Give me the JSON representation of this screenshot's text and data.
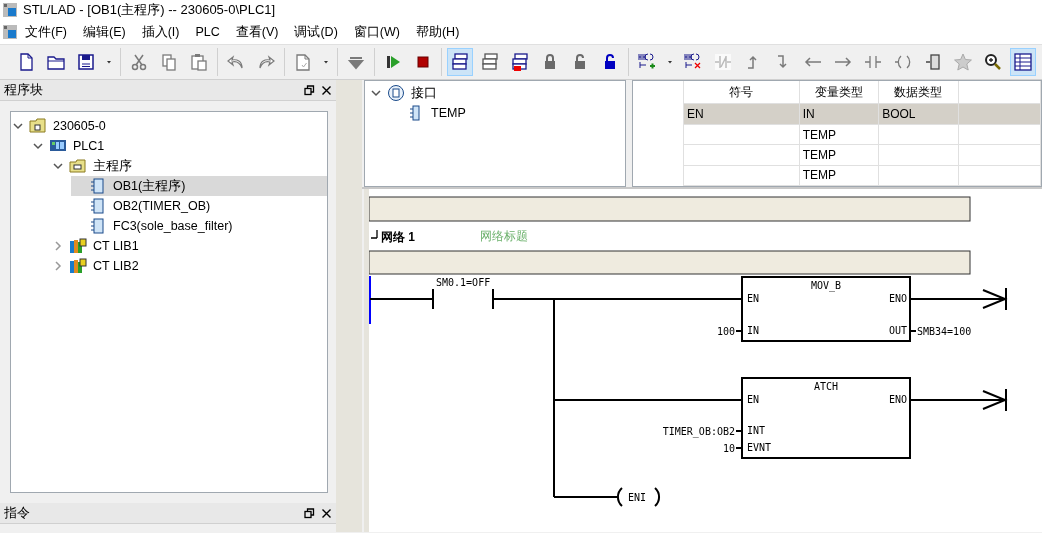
{
  "window": {
    "title": "STL/LAD - [OB1(主程序) -- 230605-0\\PLC1]"
  },
  "menu": [
    "文件(F)",
    "编辑(E)",
    "插入(I)",
    "PLC",
    "查看(V)",
    "调试(D)",
    "窗口(W)",
    "帮助(H)"
  ],
  "toolbar": {
    "groups": [
      {
        "items": [
          {
            "kind": "new-file",
            "selected": false
          },
          {
            "kind": "folder",
            "selected": false
          },
          {
            "kind": "floppy-disk",
            "selected": false
          },
          {
            "kind": "caret",
            "selected": false
          }
        ]
      },
      {
        "items": [
          {
            "kind": "scissors",
            "selected": false
          },
          {
            "kind": "copy",
            "selected": false
          },
          {
            "kind": "clipboard",
            "selected": false
          }
        ]
      },
      {
        "items": [
          {
            "kind": "undo",
            "selected": false
          },
          {
            "kind": "redo",
            "selected": false
          }
        ]
      },
      {
        "items": [
          {
            "kind": "compile",
            "selected": false
          },
          {
            "kind": "caret",
            "selected": false
          }
        ]
      },
      {
        "items": [
          {
            "kind": "download",
            "selected": false
          }
        ]
      },
      {
        "items": [
          {
            "kind": "play",
            "selected": false
          },
          {
            "kind": "stop",
            "selected": false
          }
        ]
      },
      {
        "items": [
          {
            "kind": "window-stack",
            "selected": true
          },
          {
            "kind": "window-stack-outline",
            "selected": false
          },
          {
            "kind": "window-stack-marked",
            "selected": false
          },
          {
            "kind": "lock",
            "selected": false
          },
          {
            "kind": "unlock",
            "selected": false
          },
          {
            "kind": "unlock-dropdown",
            "selected": false
          }
        ]
      },
      {
        "items": [
          {
            "kind": "insert-network",
            "selected": false
          },
          {
            "kind": "caret",
            "selected": false
          },
          {
            "kind": "delete-network",
            "selected": false
          },
          {
            "kind": "negate",
            "selected": false
          },
          {
            "kind": "line-up",
            "selected": false
          },
          {
            "kind": "line-down",
            "selected": false
          },
          {
            "kind": "arrow-left",
            "selected": false
          },
          {
            "kind": "arrow-right",
            "selected": false
          },
          {
            "kind": "contact",
            "selected": false
          },
          {
            "kind": "coil",
            "selected": false
          },
          {
            "kind": "box",
            "selected": false
          },
          {
            "kind": "star",
            "selected": false
          },
          {
            "kind": "zoom",
            "selected": false
          },
          {
            "kind": "grid",
            "selected": true
          }
        ]
      }
    ]
  },
  "program_blocks": {
    "title": "程序块",
    "items": [
      {
        "label": "230605-0",
        "kind": "project",
        "expanded": true,
        "selected": false,
        "children": [
          {
            "label": "PLC1",
            "kind": "plc",
            "expanded": true,
            "selected": false,
            "children": [
              {
                "label": "主程序",
                "kind": "folder",
                "expanded": true,
                "selected": false,
                "children": [
                  {
                    "label": "OB1(主程序)",
                    "kind": "block",
                    "selected": true
                  },
                  {
                    "label": "OB2(TIMER_OB)",
                    "kind": "block",
                    "selected": false
                  },
                  {
                    "label": "FC3(sole_base_filter)",
                    "kind": "block",
                    "selected": false
                  }
                ]
              },
              {
                "label": "CT LIB1",
                "kind": "library",
                "expanded": false,
                "selected": false
              },
              {
                "label": "CT LIB2",
                "kind": "library",
                "expanded": false,
                "selected": false
              }
            ]
          }
        ]
      }
    ]
  },
  "instructions": {
    "title": "指令"
  },
  "interface": {
    "items": [
      {
        "label": "接口",
        "kind": "interface",
        "expanded": true,
        "children": [
          {
            "label": "TEMP",
            "kind": "pin"
          }
        ]
      }
    ]
  },
  "variable_table": {
    "columns": [
      "符号",
      "变量类型",
      "数据类型"
    ],
    "rows": [
      {
        "symbol": "EN",
        "var_type": "IN",
        "data_type": "BOOL",
        "selected": true
      },
      {
        "var_type": "TEMP",
        "selected": false
      },
      {
        "var_type": "TEMP",
        "selected": false
      },
      {
        "var_type": "TEMP",
        "selected": false
      }
    ]
  },
  "ladder": {
    "network_label": "网络 1",
    "network_title": "网络标题",
    "contact": {
      "operand": "SM0.1=OFF"
    },
    "boxes": [
      {
        "name": "MOV_B",
        "inputs": [
          {
            "pin": "EN"
          },
          {
            "pin": "IN",
            "operand": "100"
          }
        ],
        "outputs": [
          {
            "pin": "ENO"
          },
          {
            "pin": "OUT",
            "operand": "SMB34=100"
          }
        ]
      },
      {
        "name": "ATCH",
        "inputs": [
          {
            "pin": "EN"
          },
          {
            "pin": "INT",
            "operand": "TIMER_OB:OB2"
          },
          {
            "pin": "EVNT",
            "operand": "10"
          }
        ],
        "outputs": [
          {
            "pin": "ENO"
          }
        ]
      }
    ],
    "coil": {
      "label": "ENI"
    }
  }
}
